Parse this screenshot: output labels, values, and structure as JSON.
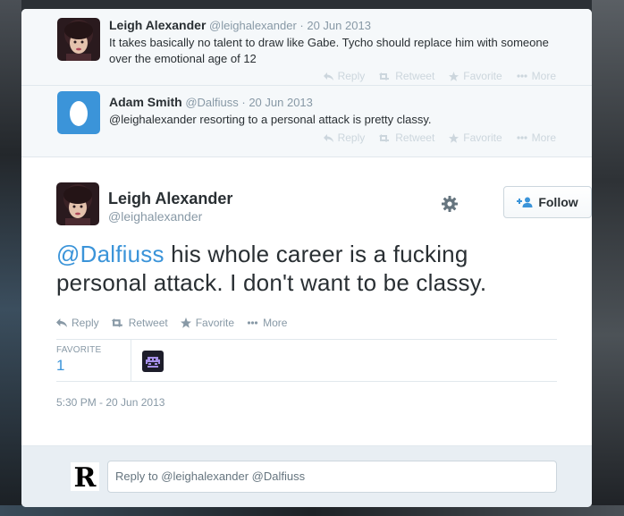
{
  "ancestors": [
    {
      "name": "Leigh Alexander",
      "handle": "@leighalexander",
      "date": "· 20 Jun 2013",
      "text": "It takes basically no talent to draw like Gabe. Tycho should replace him with someone over the emotional age of 12"
    },
    {
      "name": "Adam Smith",
      "handle": "@Dalfiuss",
      "date": "· 20 Jun 2013",
      "text": "@leighalexander resorting to a personal attack is pretty classy."
    }
  ],
  "actions": {
    "reply": "Reply",
    "retweet": "Retweet",
    "favorite": "Favorite",
    "more": "More"
  },
  "main": {
    "name": "Leigh Alexander",
    "handle": "@leighalexander",
    "follow_label": "Follow",
    "mention": "@Dalfiuss",
    "text_line1_rest": " his whole career is a fucking",
    "text_line2": "personal attack. I don't want to be classy.",
    "stats": {
      "favorite_label": "FAVORITE",
      "favorite_count": "1"
    },
    "timestamp": "5:30 PM - 20 Jun 2013"
  },
  "reply": {
    "placeholder": "Reply to @leighalexander @Dalfiuss"
  },
  "colors": {
    "link": "#3b94d9",
    "text": "#292f33",
    "muted": "#8899a6",
    "egg_bg": "#3b94d9"
  }
}
